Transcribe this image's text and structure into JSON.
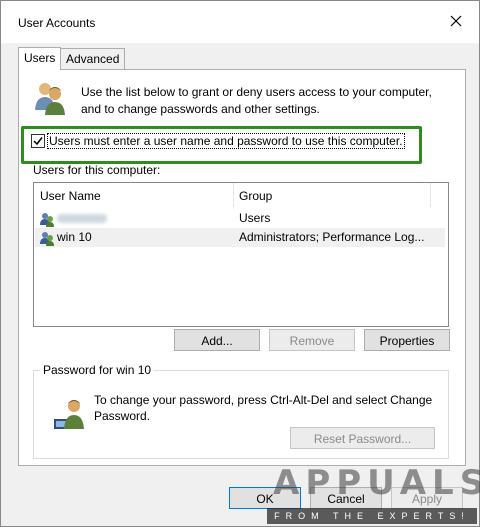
{
  "window": {
    "title": "User Accounts"
  },
  "tabs": [
    {
      "label": "Users",
      "active": true
    },
    {
      "label": "Advanced",
      "active": false
    }
  ],
  "description": "Use the list below to grant or deny users access to your computer, and to change passwords and other settings.",
  "checkbox": {
    "label": "Users must enter a user name and password to use this computer.",
    "checked": true,
    "highlight_color": "#2e8b1e"
  },
  "list": {
    "label": "Users for this computer:",
    "columns": [
      "User Name",
      "Group"
    ],
    "rows": [
      {
        "name": "",
        "name_obscured": true,
        "group": "Users",
        "selected": false
      },
      {
        "name": "win 10",
        "name_obscured": false,
        "group": "Administrators; Performance Log...",
        "selected": true
      }
    ]
  },
  "buttons": {
    "add": "Add...",
    "remove": "Remove",
    "properties": "Properties",
    "reset_password": "Reset Password...",
    "ok": "OK",
    "cancel": "Cancel",
    "apply": "Apply"
  },
  "password_group": {
    "title": "Password for win 10",
    "text": "To change your password, press Ctrl-Alt-Del and select Change Password."
  },
  "watermark": {
    "word": "APPUALS",
    "tagline": "FROM THE EXPERTS!"
  },
  "icons": {
    "users": "users-group-icon",
    "user_row": "user-icon",
    "password": "password-user-icon",
    "close": "close-icon"
  }
}
